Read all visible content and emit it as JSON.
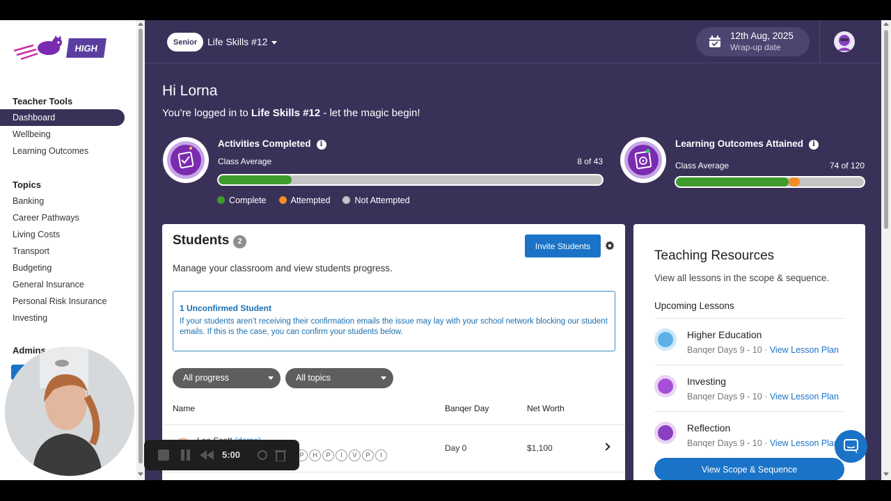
{
  "logo": {
    "badge": "HIGH"
  },
  "sidebar": {
    "teacher_tools_heading": "Teacher Tools",
    "teacher_tools": [
      "Dashboard",
      "Wellbeing",
      "Learning Outcomes"
    ],
    "topics_heading": "Topics",
    "topics": [
      "Banking",
      "Career Pathways",
      "Living Costs",
      "Transport",
      "Budgeting",
      "General Insurance",
      "Personal Risk Insurance",
      "Investing"
    ],
    "admin_heading": "Admins"
  },
  "header": {
    "level": "Senior",
    "class_name": "Life Skills #12",
    "date": "12th Aug, 2025",
    "date_label": "Wrap-up date"
  },
  "greeting": {
    "hello": "Hi Lorna",
    "logged_prefix": "You’re logged in to ",
    "logged_class": "Life Skills #12",
    "logged_suffix": " - let the magic begin!"
  },
  "activities": {
    "title": "Activities Completed",
    "sub": "Class Average",
    "count": "8 of 43",
    "complete_fraction": 0.19,
    "attempted_fraction": 0.0
  },
  "outcomes": {
    "title": "Learning Outcomes Attained",
    "sub": "Class Average",
    "count": "74 of 120",
    "complete_fraction": 0.6,
    "attempted_fraction": 0.06
  },
  "legend": {
    "complete": "Complete",
    "attempted": "Attempted",
    "not_attempted": "Not Attempted"
  },
  "colors": {
    "complete": "#3e9b2c",
    "attempted": "#f28c28",
    "not_attempted": "#c4c4c4",
    "primary": "#1a73c7",
    "brand": "#3a3159"
  },
  "students": {
    "title": "Students",
    "count": "2",
    "invite": "Invite Students",
    "desc": "Manage your classroom and view students progress.",
    "notice_title": "1 Unconfirmed Student",
    "notice_text": "If your students aren’t receiving their confirmation emails the issue may lay with your school network blocking our student emails. If this is the case, you can confirm your students below.",
    "filter_progress": "All progress",
    "filter_topics": "All topics",
    "col_name": "Name",
    "col_day": "Banqer Day",
    "col_worth": "Net Worth",
    "rows": [
      {
        "name": "Lee Scott",
        "tag": "(demo)",
        "letters": [
          "P",
          "H",
          "P",
          "I",
          "V",
          "P",
          "I"
        ],
        "day": "Day 0",
        "worth": "$1,100"
      }
    ]
  },
  "resources": {
    "title": "Teaching Resources",
    "desc": "View all lessons in the scope & sequence.",
    "upcoming": "Upcoming Lessons",
    "lessons": [
      {
        "name": "Higher Education",
        "days": "Banqer Days 9 - 10 · ",
        "link": "View Lesson Plan"
      },
      {
        "name": "Investing",
        "days": "Banqer Days 9 - 10 · ",
        "link": "View Lesson Plan"
      },
      {
        "name": "Reflection",
        "days": "Banqer Days 9 - 10 · ",
        "link": "View Lesson Plan"
      }
    ],
    "scope_button": "View Scope & Sequence"
  },
  "recorder": {
    "time": "5:00"
  }
}
